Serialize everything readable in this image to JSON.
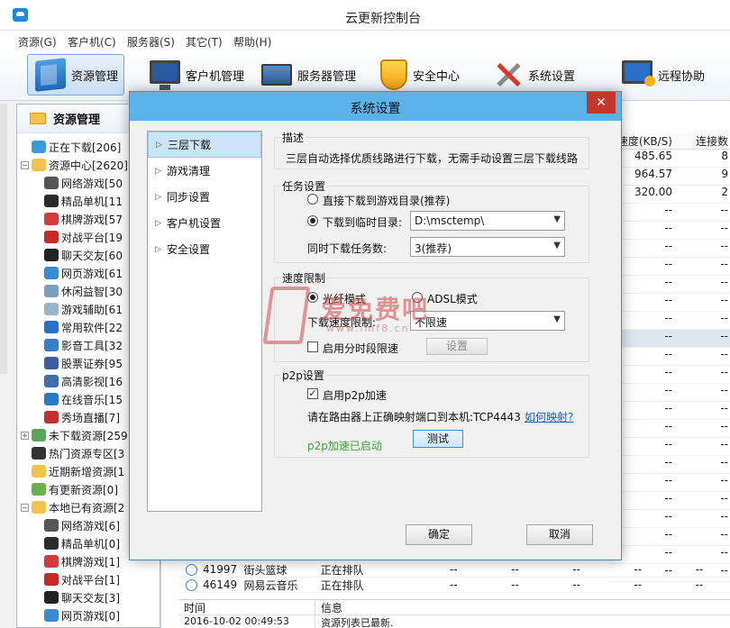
{
  "window": {
    "title": "云更新控制台"
  },
  "menu": [
    "资源(G)",
    "客户机(C)",
    "服务器(S)",
    "其它(T)",
    "帮助(H)"
  ],
  "toolbar": {
    "resource": "资源管理",
    "client": "客户机管理",
    "server": "服务器管理",
    "security": "安全中心",
    "settings": "系统设置",
    "remote": "远程协助"
  },
  "left_panel": {
    "title": "资源管理",
    "tree": [
      {
        "label": "正在下载[206]",
        "level": 0,
        "expander": "",
        "icon_color": "#3a9ad9"
      },
      {
        "label": "资源中心[2620]",
        "level": 0,
        "expander": "−",
        "icon_color": "#f3c24a"
      },
      {
        "label": "网络游戏[50",
        "level": 1,
        "expander": "",
        "icon_color": "#555555"
      },
      {
        "label": "精品单机[11",
        "level": 1,
        "expander": "",
        "icon_color": "#2b2b2b"
      },
      {
        "label": "棋牌游戏[57",
        "level": 1,
        "expander": "",
        "icon_color": "#d23b3b"
      },
      {
        "label": "对战平台[19",
        "level": 1,
        "expander": "",
        "icon_color": "#c82828"
      },
      {
        "label": "聊天交友[60",
        "level": 1,
        "expander": "",
        "icon_color": "#222222"
      },
      {
        "label": "网页游戏[61",
        "level": 1,
        "expander": "",
        "icon_color": "#3a8ad0"
      },
      {
        "label": "休闲益智[30",
        "level": 1,
        "expander": "",
        "icon_color": "#7a9ec0"
      },
      {
        "label": "游戏辅助[61",
        "level": 1,
        "expander": "",
        "icon_color": "#9ab4c8"
      },
      {
        "label": "常用软件[22",
        "level": 1,
        "expander": "",
        "icon_color": "#2a6fc6"
      },
      {
        "label": "影音工具[32",
        "level": 1,
        "expander": "",
        "icon_color": "#3a7fc6"
      },
      {
        "label": "股票证券[95",
        "level": 1,
        "expander": "",
        "icon_color": "#3a5ea0"
      },
      {
        "label": "高清影视[16",
        "level": 1,
        "expander": "",
        "icon_color": "#3f6ea8"
      },
      {
        "label": "在线音乐[15",
        "level": 1,
        "expander": "",
        "icon_color": "#2a7ac8"
      },
      {
        "label": "秀场直播[7]",
        "level": 1,
        "expander": "",
        "icon_color": "#c23030"
      },
      {
        "label": "未下载资源[259",
        "level": 0,
        "expander": "+",
        "icon_color": "#5aa55a"
      },
      {
        "label": "热门资源专区[3",
        "level": 0,
        "expander": "",
        "icon_color": "#333333"
      },
      {
        "label": "近期新增资源[1",
        "level": 0,
        "expander": "",
        "icon_color": "#f3c24a"
      },
      {
        "label": "有更新资源[0]",
        "level": 0,
        "expander": "",
        "icon_color": "#6ab04c"
      },
      {
        "label": "本地已有资源[2",
        "level": 0,
        "expander": "−",
        "icon_color": "#f3c24a"
      },
      {
        "label": "网络游戏[6]",
        "level": 1,
        "expander": "",
        "icon_color": "#555555"
      },
      {
        "label": "精品单机[0]",
        "level": 1,
        "expander": "",
        "icon_color": "#2b2b2b"
      },
      {
        "label": "棋牌游戏[1]",
        "level": 1,
        "expander": "",
        "icon_color": "#d23b3b"
      },
      {
        "label": "对战平台[1]",
        "level": 1,
        "expander": "",
        "icon_color": "#c82828"
      },
      {
        "label": "聊天交友[3]",
        "level": 1,
        "expander": "",
        "icon_color": "#222222"
      },
      {
        "label": "网页游戏[0]",
        "level": 1,
        "expander": "",
        "icon_color": "#3a8ad0"
      }
    ]
  },
  "data_table": {
    "col_speed": "速度(KB/S)",
    "col_conn": "连接数",
    "rows": [
      {
        "speed": "485.65",
        "conn": "8"
      },
      {
        "speed": "964.57",
        "conn": "9"
      },
      {
        "speed": "320.00",
        "conn": "2"
      },
      {
        "speed": "--",
        "conn": "--"
      },
      {
        "speed": "--",
        "conn": "--"
      },
      {
        "speed": "--",
        "conn": "--"
      },
      {
        "speed": "--",
        "conn": "--"
      },
      {
        "speed": "--",
        "conn": "--"
      },
      {
        "speed": "--",
        "conn": "--"
      },
      {
        "speed": "--",
        "conn": "--"
      },
      {
        "speed": "--",
        "conn": "--"
      },
      {
        "speed": "--",
        "conn": "--"
      },
      {
        "speed": "--",
        "conn": "--"
      },
      {
        "speed": "--",
        "conn": "--"
      },
      {
        "speed": "--",
        "conn": "--"
      },
      {
        "speed": "--",
        "conn": "--"
      },
      {
        "speed": "--",
        "conn": "--"
      },
      {
        "speed": "--",
        "conn": "--"
      },
      {
        "speed": "--",
        "conn": "--"
      },
      {
        "speed": "--",
        "conn": "--"
      },
      {
        "speed": "--",
        "conn": "--"
      },
      {
        "speed": "--",
        "conn": "--"
      },
      {
        "speed": "--",
        "conn": "--"
      },
      {
        "speed": "--",
        "conn": "--"
      }
    ],
    "queue": [
      {
        "id": "41997",
        "name": "街头篮球",
        "state": "正在排队",
        "d1": "--",
        "d2": "--",
        "d3": "--",
        "d4": "--",
        "d5": "--"
      },
      {
        "id": "46149",
        "name": "网易云音乐",
        "state": "正在排队",
        "d1": "--",
        "d2": "--",
        "d3": "--",
        "d4": "--",
        "d5": "--"
      }
    ]
  },
  "log": {
    "col_time": "时间",
    "col_info": "信息",
    "time": "2016-10-02 00:49:53",
    "info": "资源列表已最新."
  },
  "dialog": {
    "title": "系统设置",
    "close": "✕",
    "nav": [
      "三层下载",
      "游戏清理",
      "同步设置",
      "客户机设置",
      "安全设置"
    ],
    "desc_title": "描述",
    "desc_text": "三层自动选择优质线路进行下载，无需手动设置三层下载线路",
    "task_title": "任务设置",
    "opt_direct": "直接下载到游戏目录(推荐)",
    "opt_temp": "下载到临时目录:",
    "temp_dir": "D:\\msctemp\\",
    "concurrent_label": "同时下载任务数:",
    "concurrent_value": "3(推荐)",
    "speed_title": "速度限制",
    "opt_fiber": "光纤模式",
    "opt_adsl": "ADSL模式",
    "speed_limit_label": "下载速度限制:",
    "speed_limit_value": "不限速",
    "schedule_label": "启用分时段限速",
    "schedule_btn": "设置",
    "p2p_title": "p2p设置",
    "p2p_enable": "启用p2p加速",
    "p2p_hint": "请在路由器上正确映射端口到本机:TCP4443",
    "p2p_link": "如何映射?",
    "p2p_status": "p2p加速已启动",
    "test_btn": "测试",
    "ok_btn": "确定",
    "cancel_btn": "取消"
  },
  "watermark": {
    "text": "爱免费吧",
    "url": "www.imf8.cn"
  }
}
